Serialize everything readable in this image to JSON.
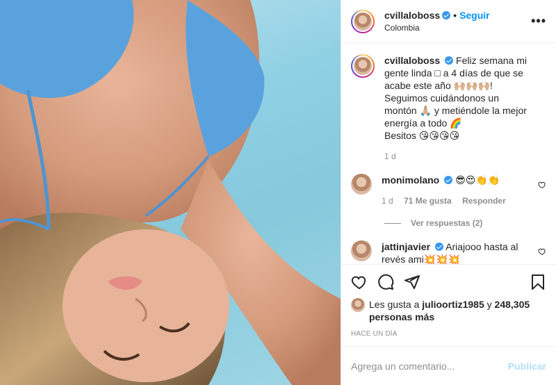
{
  "post": {
    "username": "cvillaloboss",
    "separator": "•",
    "follow_label": "Seguir",
    "location": "Colombia",
    "more_label": "•••"
  },
  "caption": {
    "username": "cvillaloboss",
    "text_1": "Feliz semana mi gente linda □ a 4 días de que se acabe este año 🙌🏼🙌🏼🙌🏼! Seguimos cuidándonos un montón 🙏🏼 y metiéndole la mejor energía a todo 🌈",
    "text_2": "Besitos 😘😘😘😘",
    "time": "1 d"
  },
  "comments": [
    {
      "username": "monimolano",
      "text": "😎😍👏👏",
      "time": "1 d",
      "likes": "71 Me gusta",
      "reply_label": "Responder",
      "replies_label": "Ver respuestas (2)"
    },
    {
      "username": "jattinjavier",
      "text": "Ariajooo hasta al revés ami💥💥💥"
    }
  ],
  "likes": {
    "prefix": "Les gusta a",
    "user": "julioortiz1985",
    "conj": "y",
    "count": "248,305 personas más"
  },
  "time_ago": "HACE UN DÍA",
  "comment_box": {
    "placeholder": "Agrega un comentario...",
    "publish_label": "Publicar"
  },
  "colors": {
    "accent": "#0095f6",
    "verified": "#3897f0",
    "publish_disabled": "#b2dffc",
    "muted": "#8e8e8e"
  },
  "icons": [
    "heart-icon",
    "comment-icon",
    "share-icon",
    "bookmark-icon",
    "verified-icon",
    "more-options-icon"
  ]
}
